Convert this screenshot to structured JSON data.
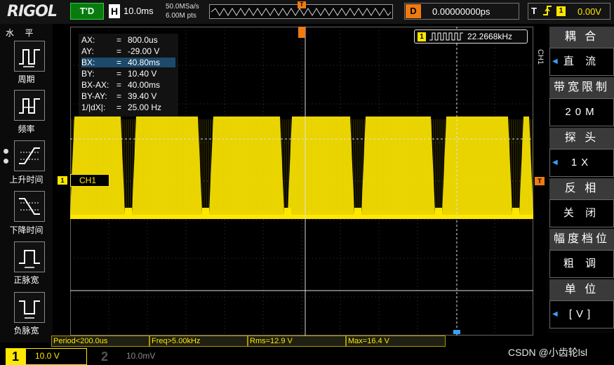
{
  "top": {
    "logo": "RIGOL",
    "run_state": "T'D",
    "timebase_badge": "H",
    "timebase": "10.0ms",
    "sample_rate": "50.0MSa/s",
    "mem_depth": "6.00M pts",
    "trig_pos_marker": "T",
    "delay_badge": "D",
    "delay": "0.00000000ps",
    "trig_label": "T",
    "trig_edge_icon": "rising-edge-icon",
    "trig_channel": "1",
    "trig_level": "0.00V"
  },
  "left": {
    "title": "水 平",
    "items": [
      {
        "label": "周期",
        "icon": "period-icon"
      },
      {
        "label": "频率",
        "icon": "frequency-icon"
      },
      {
        "label": "上升时间",
        "icon": "rise-time-icon"
      },
      {
        "label": "下降时间",
        "icon": "fall-time-icon"
      },
      {
        "label": "正脉宽",
        "icon": "positive-width-icon"
      },
      {
        "label": "负脉宽",
        "icon": "negative-width-icon"
      }
    ]
  },
  "readout": [
    {
      "k": "AX:",
      "v": "800.0us"
    },
    {
      "k": "AY:",
      "v": "-29.00 V"
    },
    {
      "k": "BX:",
      "v": "40.80ms"
    },
    {
      "k": "BY:",
      "v": "10.40 V"
    },
    {
      "k": "BX-AX:",
      "v": "40.00ms"
    },
    {
      "k": "BY-AY:",
      "v": "39.40 V"
    },
    {
      "k": "1/|dX|:",
      "v": "25.00 Hz"
    }
  ],
  "freq": {
    "channel": "1",
    "value": "22.2668kHz",
    "icon": "square-wave-icon"
  },
  "ch1_label": "CH1",
  "ch1_marker": "1",
  "right_trig_marker": "T",
  "right_menu": {
    "side_label": "CH1",
    "items": [
      {
        "head": "耦 合",
        "value": "直 流",
        "arrow": true
      },
      {
        "head": "带宽限制",
        "value": "20M",
        "arrow": false
      },
      {
        "head": "探 头",
        "value": "1X",
        "arrow": true
      },
      {
        "head": "反 相",
        "value": "关 闭",
        "arrow": false
      },
      {
        "head": "幅度档位",
        "value": "粗 调",
        "arrow": false
      },
      {
        "head": "单 位",
        "value": "[V]",
        "arrow": true
      }
    ]
  },
  "measurements": [
    {
      "text": "Period<200.0us"
    },
    {
      "text": "Freq>5.00kHz"
    },
    {
      "text": "Rms=12.9 V"
    },
    {
      "text": "Max=16.4 V"
    }
  ],
  "bottom": {
    "ch1_num": "1",
    "ch1_scale": "10.0 V",
    "ch2_num": "2",
    "ch2_scale": "10.0mV"
  },
  "watermark": "CSDN @小齿轮lsl",
  "colors": {
    "ch1": "#ffe800",
    "trigger": "#f07a10",
    "cursor_highlight": "#1d4a6a",
    "cursor_b": "#3aa0ff"
  }
}
